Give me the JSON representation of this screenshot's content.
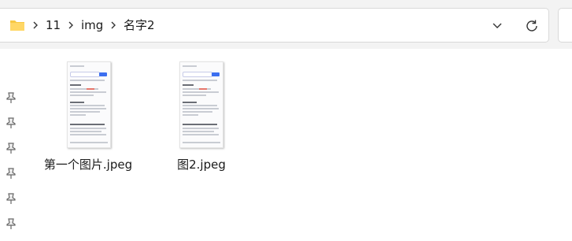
{
  "breadcrumb": [
    "11",
    "img",
    "名字2"
  ],
  "icons": {
    "folder": "folder-icon",
    "separator": "chevron-right-icon",
    "dropdown": "chevron-down-icon",
    "refresh": "refresh-icon",
    "pin": "pin-icon"
  },
  "files": [
    {
      "name": "第一个图片.jpeg"
    },
    {
      "name": "图2.jpeg"
    }
  ],
  "colors": {
    "folder_yellow": "#f7c844",
    "accent_blue": "#3c6ff0"
  }
}
